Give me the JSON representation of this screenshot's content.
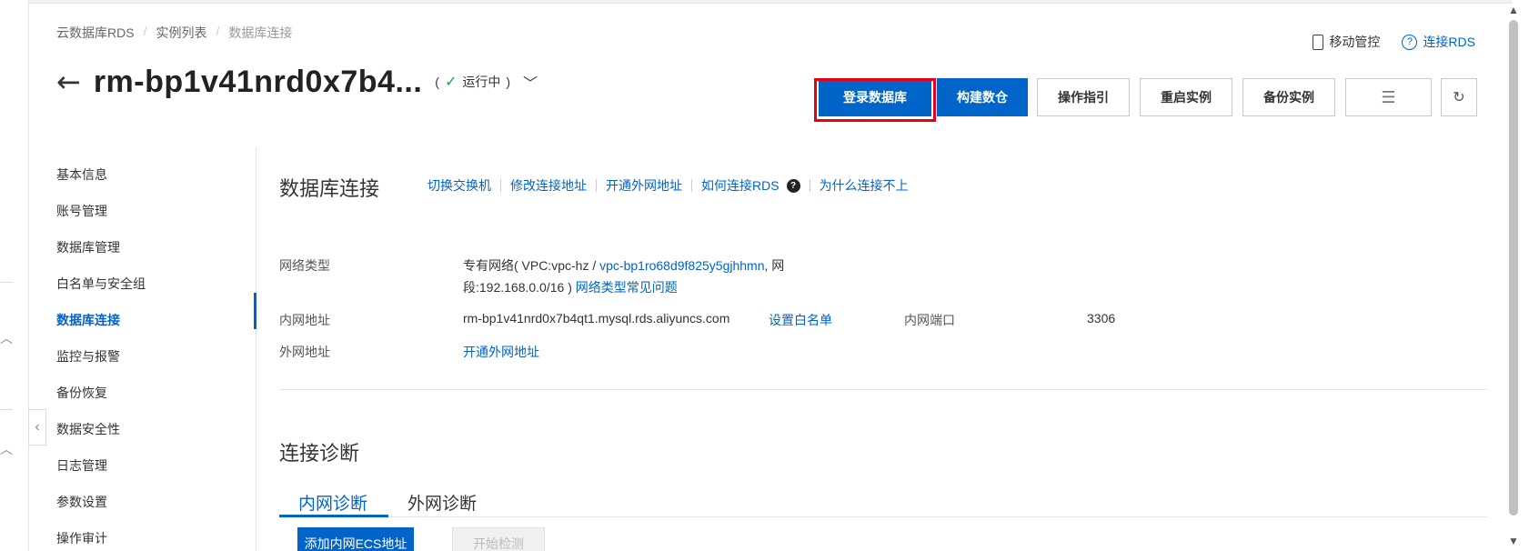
{
  "breadcrumb": [
    "云数据库RDS",
    "实例列表",
    "数据库连接"
  ],
  "instance": {
    "title": "rm-bp1v41nrd0x7b4...",
    "status_open": "(",
    "status": "运行中",
    "status_close": ")"
  },
  "toplinks": {
    "mobile": "移动管控",
    "connect": "连接RDS"
  },
  "buttons": {
    "login": "登录数据库",
    "build_warehouse": "构建数仓",
    "guide": "操作指引",
    "restart": "重启实例",
    "backup": "备份实例"
  },
  "sidebar": [
    {
      "label": "基本信息",
      "active": false
    },
    {
      "label": "账号管理",
      "active": false
    },
    {
      "label": "数据库管理",
      "active": false
    },
    {
      "label": "白名单与安全组",
      "active": false
    },
    {
      "label": "数据库连接",
      "active": true
    },
    {
      "label": "监控与报警",
      "active": false
    },
    {
      "label": "备份恢复",
      "active": false
    },
    {
      "label": "数据安全性",
      "active": false
    },
    {
      "label": "日志管理",
      "active": false
    },
    {
      "label": "参数设置",
      "active": false
    },
    {
      "label": "操作审计",
      "active": false
    }
  ],
  "connection": {
    "title": "数据库连接",
    "links": [
      "切换交换机",
      "修改连接地址",
      "开通外网地址",
      "如何连接RDS",
      "为什么连接不上"
    ],
    "network_type_label": "网络类型",
    "network_type_prefix": "专有网络( VPC:vpc-hz / ",
    "vpc_link": "vpc-bp1ro68d9f825y5gjhhmn",
    "network_type_mid": ", 网",
    "network_type_line2": "段:192.168.0.0/16 )",
    "network_faq": "网络类型常见问题",
    "intranet_label": "内网地址",
    "intranet_value": "rm-bp1v41nrd0x7b4qt1.mysql.rds.aliyuncs.com",
    "set_whitelist": "设置白名单",
    "intranet_port_label": "内网端口",
    "intranet_port": "3306",
    "internet_label": "外网地址",
    "open_internet": "开通外网地址"
  },
  "diagnosis": {
    "title": "连接诊断",
    "tabs": [
      "内网诊断",
      "外网诊断"
    ],
    "add_button": "添加内网ECS地址",
    "start_button": "开始检测"
  },
  "colors": {
    "primary": "#0064c8",
    "highlight": "#e60012",
    "success": "#1ea34a"
  }
}
